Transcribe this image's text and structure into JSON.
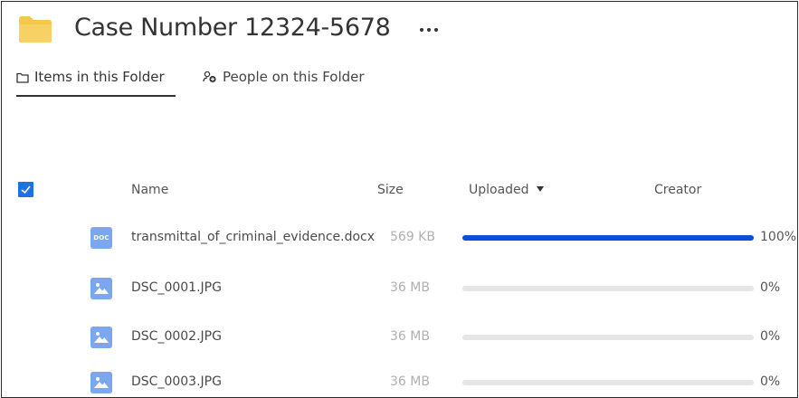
{
  "header": {
    "title": "Case Number 12324-5678"
  },
  "tabs": [
    {
      "label": "Items in this Folder",
      "active": true
    },
    {
      "label": "People on this Folder",
      "active": false
    }
  ],
  "table": {
    "select_all_checked": true,
    "columns": {
      "name": "Name",
      "size": "Size",
      "uploaded": "Uploaded",
      "creator": "Creator"
    },
    "rows": [
      {
        "icon": "doc-file-icon",
        "badge": "DOC",
        "name": "transmittal_of_criminal_evidence.docx",
        "size": "569 KB",
        "progress": 1.0,
        "progress_label": "100%"
      },
      {
        "icon": "image-file-icon",
        "name": "DSC_0001.JPG",
        "size": "36 MB",
        "progress": 0.0,
        "progress_label": "0%"
      },
      {
        "icon": "image-file-icon",
        "name": "DSC_0002.JPG",
        "size": "36 MB",
        "progress": 0.0,
        "progress_label": "0%"
      },
      {
        "icon": "image-file-icon",
        "name": "DSC_0003.JPG",
        "size": "36 MB",
        "progress": 0.0,
        "progress_label": "0%"
      }
    ]
  },
  "colors": {
    "accent": "#1f6fe5",
    "progress_fill": "#0a4fd6",
    "progress_track": "#e6e6e6",
    "folder": "#f5c84c",
    "file_icon": "#7aa7ee"
  }
}
